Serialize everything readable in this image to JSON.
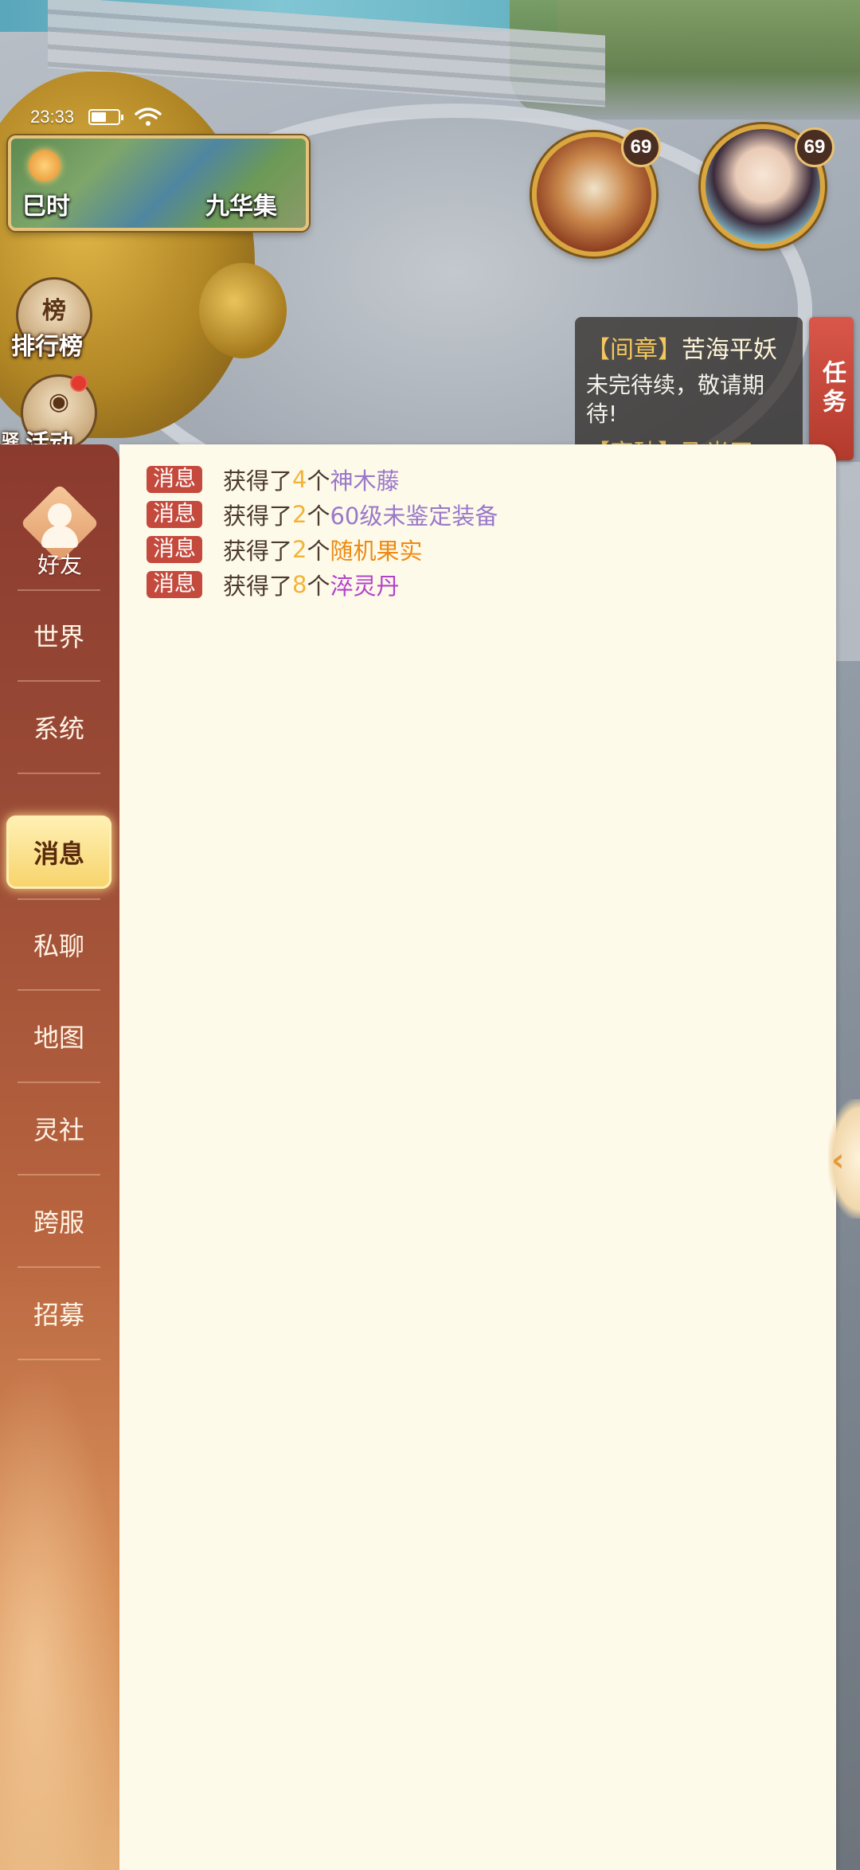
{
  "status_bar": {
    "time": "23:33"
  },
  "minimap": {
    "time_of_day": "巳时",
    "location": "九华集"
  },
  "side_buttons": {
    "ranking": "排行榜",
    "activity": "活动",
    "partial_label": "驿"
  },
  "avatars": {
    "pet_level": "69",
    "hero_level": "69"
  },
  "quest": {
    "title_bracket": "【间章】",
    "title_name": "苦海平妖",
    "description": "未完待续，敬请期待!",
    "next_title": "【突破】飞光天",
    "tab_label": "任务"
  },
  "chat": {
    "friend_label": "好友",
    "channels": [
      "世界",
      "系统",
      "消息",
      "私聊",
      "地图",
      "灵社",
      "跨服",
      "招募"
    ],
    "active_channel": "消息",
    "messages": [
      {
        "tag": "消息",
        "prefix": "获得了",
        "count": "4",
        "unit": "个",
        "item": "神木藤",
        "item_color": "#9a78c9"
      },
      {
        "tag": "消息",
        "prefix": "获得了",
        "count": "2",
        "unit": "个",
        "item": "60级未鉴定装备",
        "item_color": "#9a78c9"
      },
      {
        "tag": "消息",
        "prefix": "获得了",
        "count": "2",
        "unit": "个",
        "item": "随机果实",
        "item_color": "#ee8a12"
      },
      {
        "tag": "消息",
        "prefix": "获得了",
        "count": "8",
        "unit": "个",
        "item": "淬灵丹",
        "item_color": "#b342c9"
      }
    ]
  },
  "colors": {
    "panel_bg": "#fefaea",
    "tag_bg": "#c44a3d",
    "count_color": "#f0b43a",
    "sidebar_top": "#8b3a2e",
    "active_tab": "#f7d36a"
  }
}
